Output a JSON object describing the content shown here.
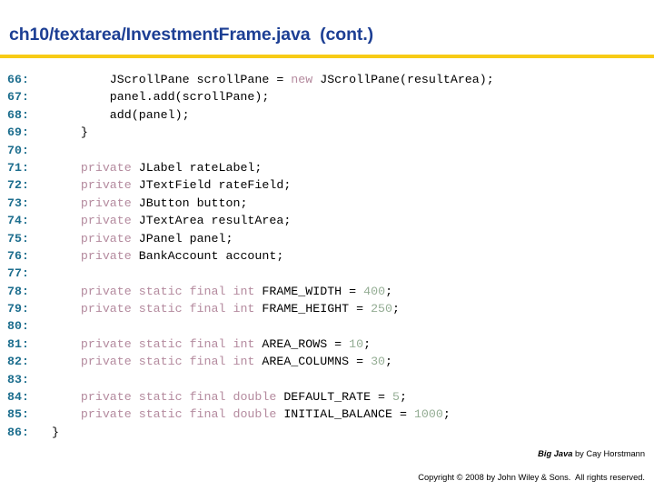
{
  "slide": {
    "title": "ch10/textarea/InvestmentFrame.java  (cont.)",
    "rule_color": "#f7cb15",
    "title_color": "#1d3f94"
  },
  "code": {
    "lineno_color": "#1d6e8e",
    "keyword_color": "#b48a9e",
    "number_color": "#94ad94",
    "text_color": "#000000",
    "lines": [
      {
        "no": "66:",
        "segments": [
          {
            "t": "          JScrollPane scrollPane = ",
            "c": "plain"
          },
          {
            "t": "new",
            "c": "kw"
          },
          {
            "t": " JScrollPane(resultArea);",
            "c": "plain"
          }
        ]
      },
      {
        "no": "67:",
        "segments": [
          {
            "t": "          panel.add(scrollPane);",
            "c": "plain"
          }
        ]
      },
      {
        "no": "68:",
        "segments": [
          {
            "t": "          add(panel);",
            "c": "plain"
          }
        ]
      },
      {
        "no": "69:",
        "segments": [
          {
            "t": "      }",
            "c": "plain"
          }
        ]
      },
      {
        "no": "70:",
        "segments": [
          {
            "t": "",
            "c": "plain"
          }
        ]
      },
      {
        "no": "71:",
        "segments": [
          {
            "t": "      ",
            "c": "plain"
          },
          {
            "t": "private",
            "c": "kw"
          },
          {
            "t": " JLabel rateLabel;",
            "c": "plain"
          }
        ]
      },
      {
        "no": "72:",
        "segments": [
          {
            "t": "      ",
            "c": "plain"
          },
          {
            "t": "private",
            "c": "kw"
          },
          {
            "t": " JTextField rateField;",
            "c": "plain"
          }
        ]
      },
      {
        "no": "73:",
        "segments": [
          {
            "t": "      ",
            "c": "plain"
          },
          {
            "t": "private",
            "c": "kw"
          },
          {
            "t": " JButton button;",
            "c": "plain"
          }
        ]
      },
      {
        "no": "74:",
        "segments": [
          {
            "t": "      ",
            "c": "plain"
          },
          {
            "t": "private",
            "c": "kw"
          },
          {
            "t": " JTextArea resultArea;",
            "c": "plain"
          }
        ]
      },
      {
        "no": "75:",
        "segments": [
          {
            "t": "      ",
            "c": "plain"
          },
          {
            "t": "private",
            "c": "kw"
          },
          {
            "t": " JPanel panel;",
            "c": "plain"
          }
        ]
      },
      {
        "no": "76:",
        "segments": [
          {
            "t": "      ",
            "c": "plain"
          },
          {
            "t": "private",
            "c": "kw"
          },
          {
            "t": " BankAccount account;",
            "c": "plain"
          }
        ]
      },
      {
        "no": "77:",
        "segments": [
          {
            "t": "",
            "c": "plain"
          }
        ]
      },
      {
        "no": "78:",
        "segments": [
          {
            "t": "      ",
            "c": "plain"
          },
          {
            "t": "private static final int",
            "c": "kw"
          },
          {
            "t": " FRAME_WIDTH = ",
            "c": "plain"
          },
          {
            "t": "400",
            "c": "num"
          },
          {
            "t": ";",
            "c": "plain"
          }
        ]
      },
      {
        "no": "79:",
        "segments": [
          {
            "t": "      ",
            "c": "plain"
          },
          {
            "t": "private static final int",
            "c": "kw"
          },
          {
            "t": " FRAME_HEIGHT = ",
            "c": "plain"
          },
          {
            "t": "250",
            "c": "num"
          },
          {
            "t": ";",
            "c": "plain"
          }
        ]
      },
      {
        "no": "80:",
        "segments": [
          {
            "t": "",
            "c": "plain"
          }
        ]
      },
      {
        "no": "81:",
        "segments": [
          {
            "t": "      ",
            "c": "plain"
          },
          {
            "t": "private static final int",
            "c": "kw"
          },
          {
            "t": " AREA_ROWS = ",
            "c": "plain"
          },
          {
            "t": "10",
            "c": "num"
          },
          {
            "t": ";",
            "c": "plain"
          }
        ]
      },
      {
        "no": "82:",
        "segments": [
          {
            "t": "      ",
            "c": "plain"
          },
          {
            "t": "private static final int",
            "c": "kw"
          },
          {
            "t": " AREA_COLUMNS = ",
            "c": "plain"
          },
          {
            "t": "30",
            "c": "num"
          },
          {
            "t": ";",
            "c": "plain"
          }
        ]
      },
      {
        "no": "83:",
        "segments": [
          {
            "t": "",
            "c": "plain"
          }
        ]
      },
      {
        "no": "84:",
        "segments": [
          {
            "t": "      ",
            "c": "plain"
          },
          {
            "t": "private static final double",
            "c": "kw"
          },
          {
            "t": " DEFAULT_RATE = ",
            "c": "plain"
          },
          {
            "t": "5",
            "c": "num"
          },
          {
            "t": ";",
            "c": "plain"
          }
        ]
      },
      {
        "no": "85:",
        "segments": [
          {
            "t": "      ",
            "c": "plain"
          },
          {
            "t": "private static final double",
            "c": "kw"
          },
          {
            "t": " INITIAL_BALANCE = ",
            "c": "plain"
          },
          {
            "t": "1000",
            "c": "num"
          },
          {
            "t": ";",
            "c": "plain"
          }
        ]
      },
      {
        "no": "86:",
        "segments": [
          {
            "t": "  }",
            "c": "plain"
          }
        ]
      }
    ]
  },
  "footer": {
    "book_title": "Big Java",
    "attribution": " by Cay Horstmann",
    "copyright": "Copyright © 2008 by John Wiley & Sons.  All rights reserved."
  }
}
